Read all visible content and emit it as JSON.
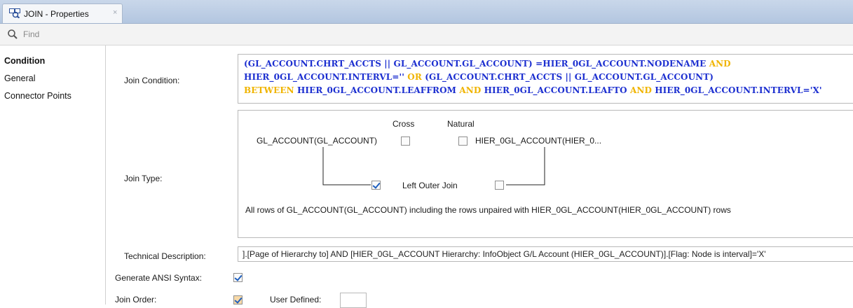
{
  "tab": {
    "title": "JOIN - Properties",
    "close": "×"
  },
  "find": {
    "placeholder": "Find"
  },
  "nav": {
    "items": [
      {
        "label": "Condition",
        "selected": true
      },
      {
        "label": "General",
        "selected": false
      },
      {
        "label": "Connector Points",
        "selected": false
      }
    ]
  },
  "labels": {
    "join_condition": "Join Condition:",
    "join_type": "Join Type:",
    "technical_description": "Technical Description:",
    "generate_ansi": "Generate ANSI Syntax:",
    "join_order": "Join Order:",
    "user_defined": "User Defined:"
  },
  "join_condition": {
    "line1_a": "(GL_ACCOUNT.CHRT_ACCTS || GL_ACCOUNT.GL_ACCOUNT) =HIER_0GL_ACCOUNT.NODENAME ",
    "line1_kw": "AND",
    "line2_a": "HIER_0GL_ACCOUNT.INTERVL='' ",
    "line2_kw": "OR",
    "line2_b": " (GL_ACCOUNT.CHRT_ACCTS || GL_ACCOUNT.GL_ACCOUNT)",
    "line3_kw1": "BETWEEN",
    "line3_a": " HIER_0GL_ACCOUNT.LEAFFROM ",
    "line3_kw2": "AND",
    "line3_b": " HIER_0GL_ACCOUNT.LEAFTO ",
    "line3_kw3": "AND",
    "line3_c": " HIER_0GL_ACCOUNT.INTERVL='X'"
  },
  "join_type": {
    "cross_label": "Cross",
    "natural_label": "Natural",
    "left_table": "GL_ACCOUNT(GL_ACCOUNT)",
    "right_table": "HIER_0GL_ACCOUNT(HIER_0...",
    "outer_join_label": "Left Outer Join",
    "cross_checked": false,
    "natural_checked": false,
    "left_outer_checked": true,
    "right_outer_checked": false,
    "description": "All rows of GL_ACCOUNT(GL_ACCOUNT) including the rows unpaired with HIER_0GL_ACCOUNT(HIER_0GL_ACCOUNT) rows"
  },
  "technical_description": "].[Page of Hierarchy to] AND [HIER_0GL_ACCOUNT Hierarchy: InfoObject G/L Account (HIER_0GL_ACCOUNT)].[Flag: Node is interval]='X'",
  "generate_ansi_checked": true,
  "join_order": {
    "user_defined_checked": true,
    "value": ""
  },
  "colors": {
    "keyword": "#f0b400",
    "identifier": "#1c2fd0",
    "tabbar": "#b3c6e0"
  }
}
